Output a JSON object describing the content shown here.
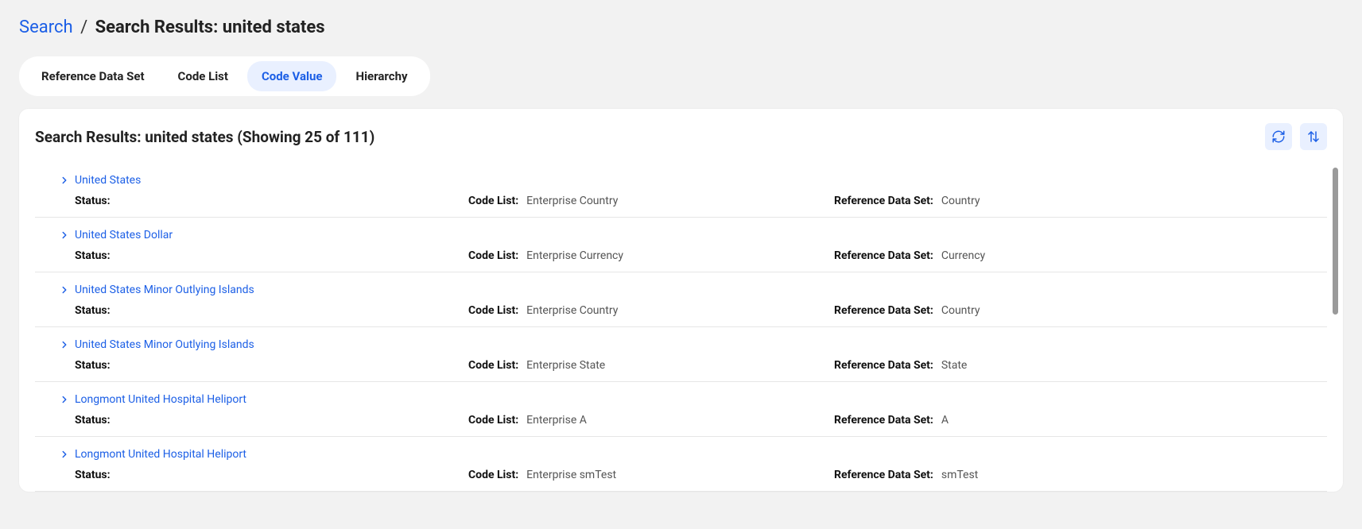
{
  "breadcrumb": {
    "root": "Search",
    "separator": "/",
    "current": "Search Results: united states"
  },
  "tabs": [
    {
      "label": "Reference Data Set",
      "active": false
    },
    {
      "label": "Code List",
      "active": false
    },
    {
      "label": "Code Value",
      "active": true
    },
    {
      "label": "Hierarchy",
      "active": false
    }
  ],
  "panel": {
    "title": "Search Results: united states (Showing 25 of 111)"
  },
  "labels": {
    "status": "Status:",
    "codeList": "Code List:",
    "refSet": "Reference Data Set:"
  },
  "results": [
    {
      "title": "United States",
      "status": "",
      "codeList": "Enterprise Country",
      "refSet": "Country"
    },
    {
      "title": "United States Dollar",
      "status": "",
      "codeList": "Enterprise Currency",
      "refSet": "Currency"
    },
    {
      "title": "United States Minor Outlying Islands",
      "status": "",
      "codeList": "Enterprise Country",
      "refSet": "Country"
    },
    {
      "title": "United States Minor Outlying Islands",
      "status": "",
      "codeList": "Enterprise State",
      "refSet": "State"
    },
    {
      "title": "Longmont United Hospital Heliport",
      "status": "",
      "codeList": "Enterprise A",
      "refSet": "A"
    },
    {
      "title": "Longmont United Hospital Heliport",
      "status": "",
      "codeList": "Enterprise smTest",
      "refSet": "smTest"
    }
  ]
}
